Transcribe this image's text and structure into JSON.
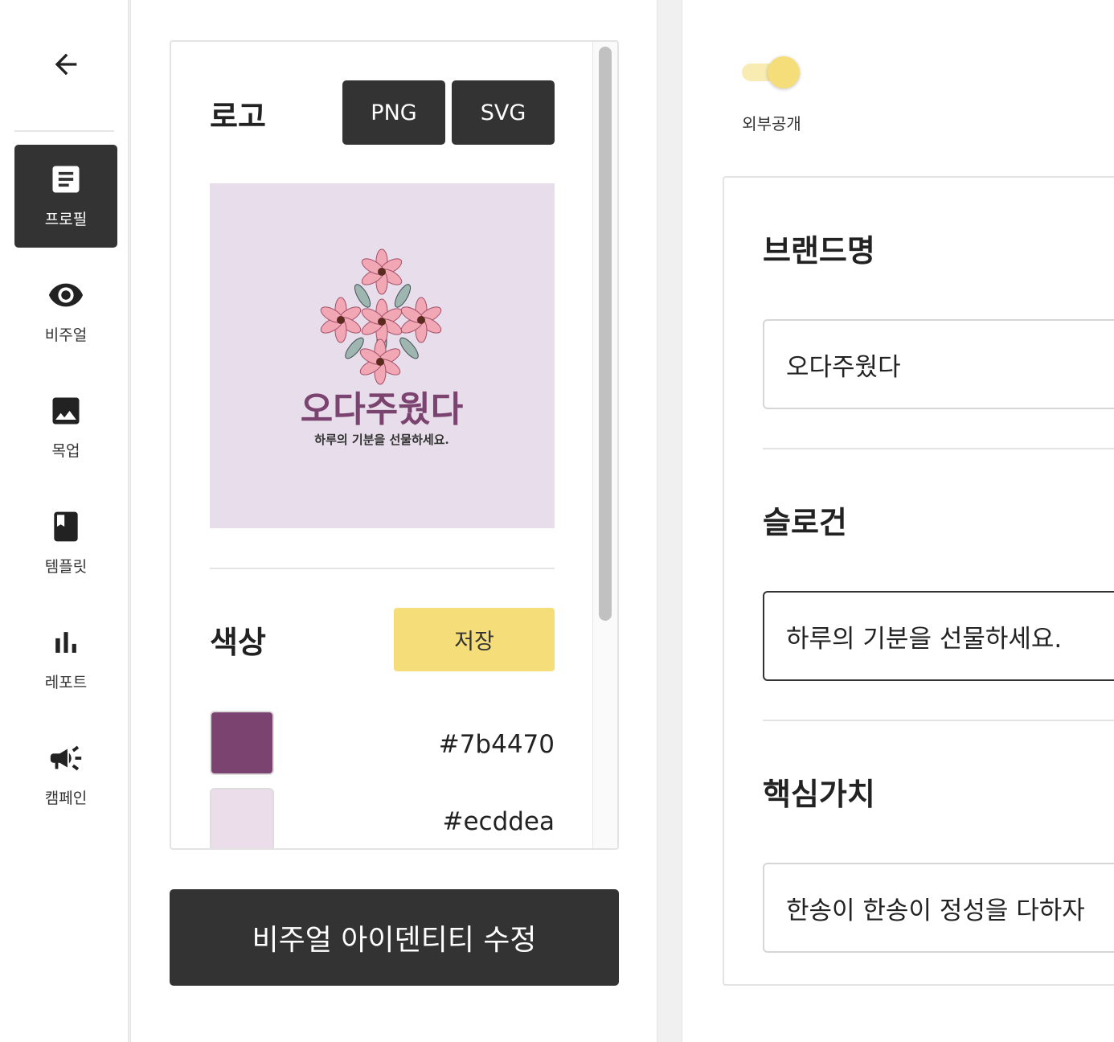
{
  "sidebar": {
    "back_icon": "arrow-left-icon",
    "items": [
      {
        "label": "프로필",
        "icon": "document-icon",
        "active": true
      },
      {
        "label": "비주얼",
        "icon": "eye-icon",
        "active": false
      },
      {
        "label": "목업",
        "icon": "image-icon",
        "active": false
      },
      {
        "label": "템플릿",
        "icon": "bookmark-book-icon",
        "active": false
      },
      {
        "label": "레포트",
        "icon": "bar-chart-icon",
        "active": false
      },
      {
        "label": "캠페인",
        "icon": "megaphone-icon",
        "active": false
      }
    ]
  },
  "visual": {
    "logo_title": "로고",
    "png_label": "PNG",
    "svg_label": "SVG",
    "logo": {
      "brand_text": "오다주웠다",
      "slogan_text": "하루의 기분을 선물하세요.",
      "background": "#e8ddea",
      "text_color": "#7b4470",
      "flower_color": "#f2a7b4"
    },
    "color_title": "색상",
    "save_label": "저장",
    "colors": [
      {
        "hex": "#7b4470"
      },
      {
        "hex": "#ecddea"
      }
    ],
    "edit_button_label": "비주얼 아이덴티티 수정"
  },
  "profile": {
    "public_toggle": {
      "label": "외부공개",
      "on": true
    },
    "brand_name": {
      "title": "브랜드명",
      "value": "오다주웠다"
    },
    "slogan": {
      "title": "슬로건",
      "value": "하루의 기분을 선물하세요."
    },
    "core_value": {
      "title": "핵심가치",
      "value": "한송이 한송이 정성을 다하자"
    }
  },
  "colors": {
    "dark": "#333333",
    "accent_yellow": "#f5de7a",
    "toggle_track": "#f8ecb2"
  }
}
